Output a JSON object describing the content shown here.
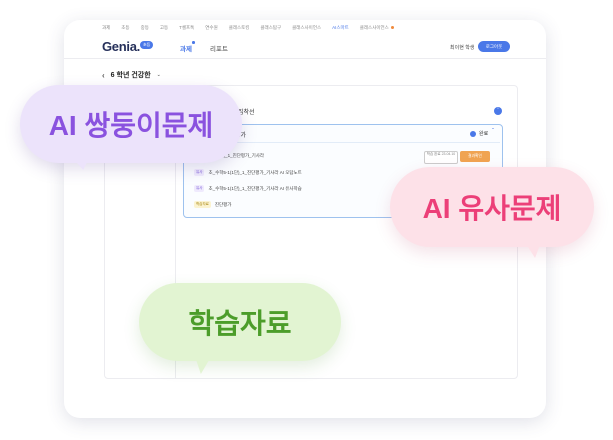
{
  "topnav": {
    "items": [
      "과제",
      "초등",
      "중등",
      "고등",
      "T셀프톡",
      "연수원",
      "클래스토킹",
      "클래스탐구",
      "클래스사이언스",
      "AI스마트",
      "클래스사이언스"
    ],
    "active_index": 9
  },
  "header": {
    "logo": "Genia.",
    "logo_badge": "초등",
    "nav": {
      "task": "과제",
      "report": "리포트"
    },
    "user": "최이현 학생",
    "login_button": "로그아웃"
  },
  "page": {
    "title": "6 학년 건강한",
    "selector_icon": "chevron-down-icon"
  },
  "section": {
    "title": "집착선"
  },
  "box": {
    "title": "진단평가",
    "status": "완료",
    "items": [
      {
        "tag": "",
        "text": "초_수학5-1(1단)_1_진단평가_기사라"
      },
      {
        "tag": "유사",
        "text": "초_수학5-1(1단)_1_진단평가_기사라 AI 오답노트"
      },
      {
        "tag": "유사",
        "text": "초_수학5-1(1단)_1_진단평가_기사라 AI 유사학습"
      },
      {
        "tag": "학습자료",
        "text": "진단평가"
      }
    ],
    "status_button": "학습 완료 23.04.10",
    "result_button": "결과확인"
  },
  "bubbles": {
    "purple": "AI 쌍둥이문제",
    "pink": "AI 유사문제",
    "green": "학습자료"
  },
  "colors": {
    "accent": "#4a78e8",
    "purple": "#8a52df",
    "pink": "#ec3f78",
    "green": "#4c9d2a",
    "result": "#f0a452"
  }
}
